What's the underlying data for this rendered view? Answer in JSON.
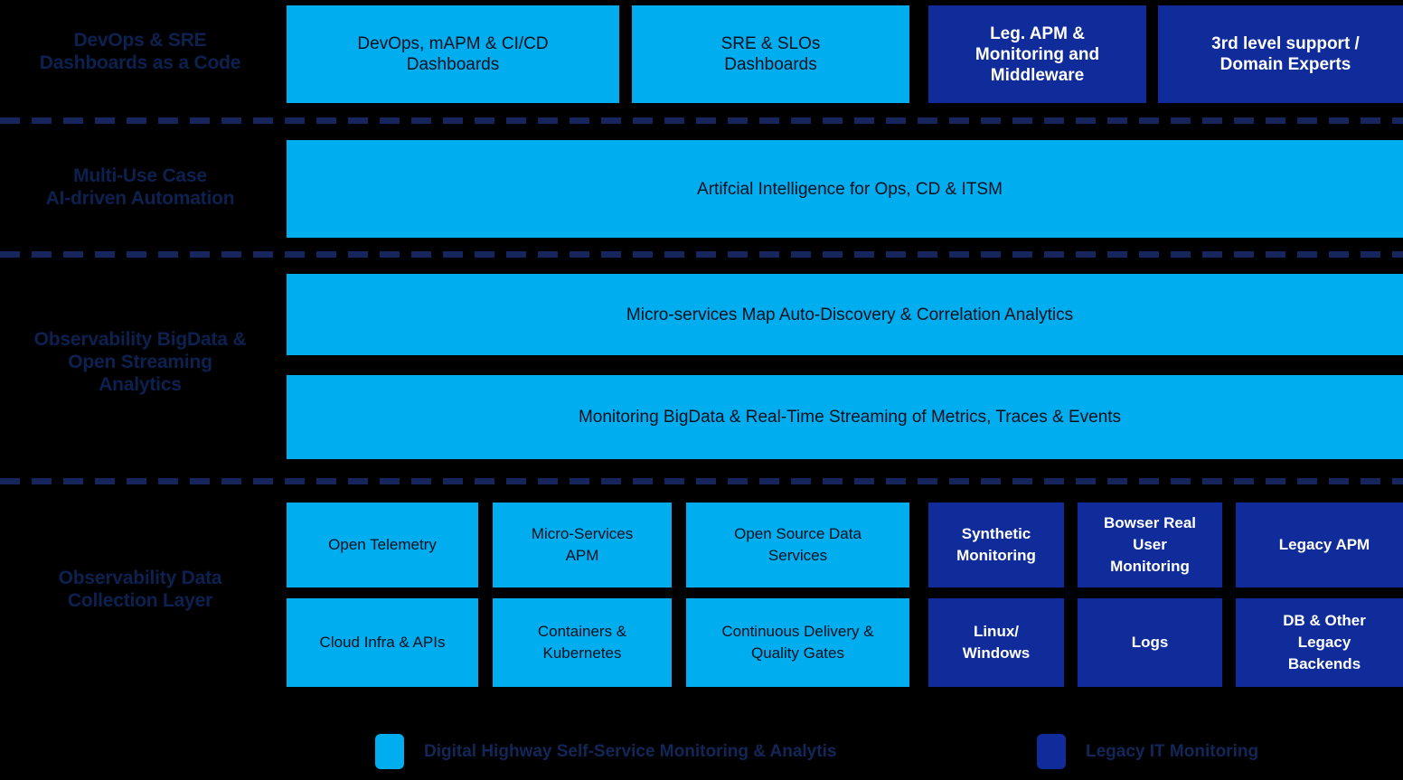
{
  "diagram": {
    "background_color": "#000000",
    "accent_cyan": "#00ADEE",
    "accent_navy": "#102C9B",
    "label_color": "#0d2150"
  },
  "rows": [
    {
      "label": "DevOps & SRE\nDashboards as a Code",
      "boxes": [
        {
          "text": "DevOps, mAPM & CI/CD\nDashboards",
          "color": "cyan"
        },
        {
          "text": "SRE & SLOs\nDashboards",
          "color": "cyan"
        },
        {
          "text": "Leg. APM &\nMonitoring and\nMiddleware",
          "color": "navy"
        },
        {
          "text": "3rd level support /\nDomain Experts",
          "color": "navy"
        }
      ]
    },
    {
      "label": "Multi-Use Case\nAI-driven Automation",
      "boxes": [
        {
          "text": "Artifcial Intelligence for Ops, CD & ITSM",
          "color": "cyan"
        }
      ]
    },
    {
      "label": "Observability BigData &\nOpen Streaming\nAnalytics",
      "boxes": [
        {
          "text": "Micro-services Map Auto-Discovery &  Correlation Analytics",
          "color": "cyan"
        },
        {
          "text": "Monitoring BigData & Real-Time Streaming of Metrics, Traces & Events",
          "color": "cyan"
        }
      ]
    },
    {
      "label": "Observability Data\nCollection Layer",
      "boxes": [
        {
          "text": "Open Telemetry",
          "color": "cyan"
        },
        {
          "text": "Micro-Services\nAPM",
          "color": "cyan"
        },
        {
          "text": "Open Source Data\nServices",
          "color": "cyan"
        },
        {
          "text": "Synthetic\nMonitoring",
          "color": "navy"
        },
        {
          "text": "Bowser Real\nUser\nMonitoring",
          "color": "navy"
        },
        {
          "text": "Legacy APM",
          "color": "navy"
        },
        {
          "text": "Cloud Infra & APIs",
          "color": "cyan"
        },
        {
          "text": "Containers &\nKubernetes",
          "color": "cyan"
        },
        {
          "text": "Continuous Delivery &\nQuality Gates",
          "color": "cyan"
        },
        {
          "text": "Linux/\nWindows",
          "color": "navy"
        },
        {
          "text": "Logs",
          "color": "navy"
        },
        {
          "text": "DB & Other\nLegacy\nBackends",
          "color": "navy"
        }
      ]
    }
  ],
  "legend": [
    {
      "swatch": "cyan",
      "label": "Digital Highway Self-Service Monitoring & Analytis"
    },
    {
      "swatch": "navy",
      "label": "Legacy IT Monitoring"
    }
  ]
}
